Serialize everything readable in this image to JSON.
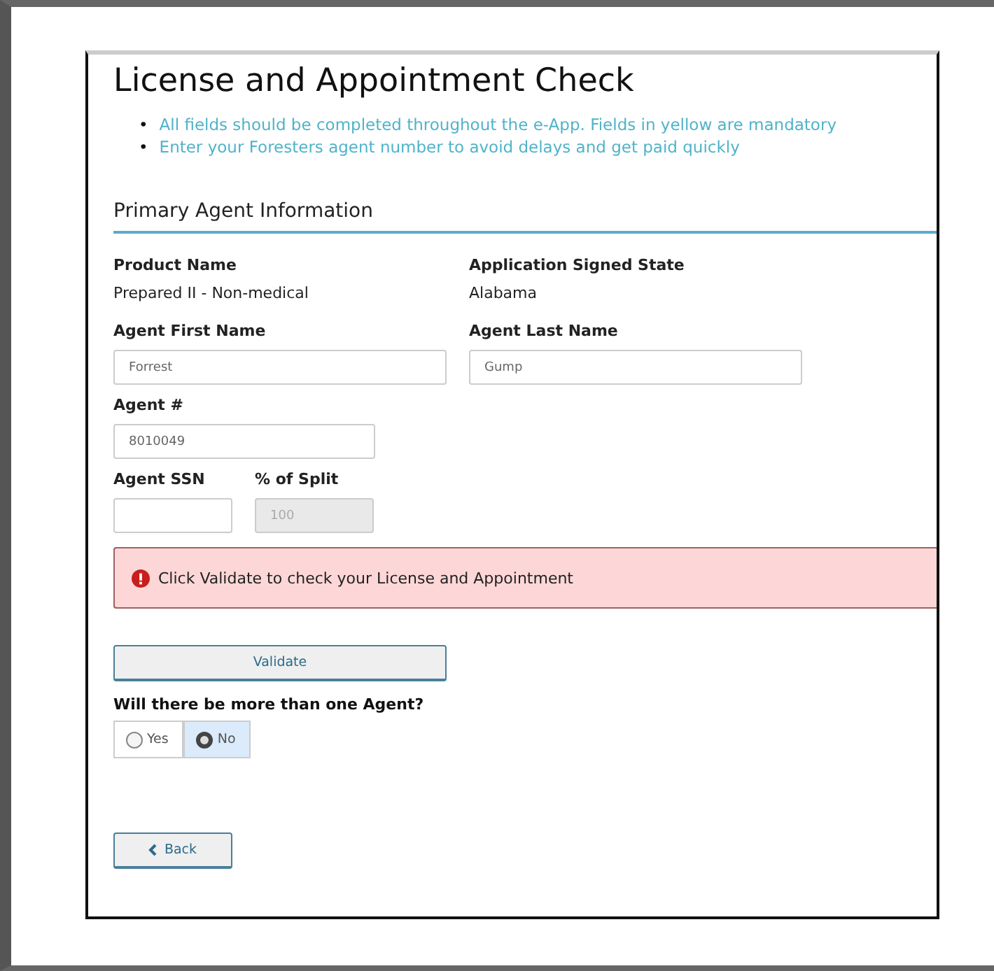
{
  "title": "License and Appointment Check",
  "notes": [
    {
      "bullet": "•",
      "text": "All fields should be completed throughout the e-App. Fields in yellow are mandatory"
    },
    {
      "bullet": "•",
      "text": "Enter your Foresters agent number to avoid delays and get paid quickly"
    }
  ],
  "section_title": "Primary Agent Information",
  "info": [
    {
      "label": "Product Name",
      "value": "Prepared II - Non-medical"
    },
    {
      "label": "Application Signed State",
      "value": "Alabama"
    }
  ],
  "name_fields": [
    {
      "label": "Agent First Name",
      "value": "Forrest",
      "disabled": false
    },
    {
      "label": "Agent Last Name",
      "value": "Gump",
      "disabled": false
    }
  ],
  "agent_number": {
    "label": "Agent #",
    "value": "8010049",
    "disabled": false
  },
  "small_fields": [
    {
      "label": "Agent SSN",
      "disabled": false
    },
    {
      "label": "% of Split",
      "value": "100",
      "disabled": true
    }
  ],
  "alert": {
    "text": "Click Validate to check your License and Appointment"
  },
  "validate_button": "Validate",
  "question": "Will there be more than one Agent?",
  "options": [
    {
      "label": "Yes",
      "selected": false
    },
    {
      "label": "No",
      "selected": true
    }
  ],
  "back_button": "Back"
}
